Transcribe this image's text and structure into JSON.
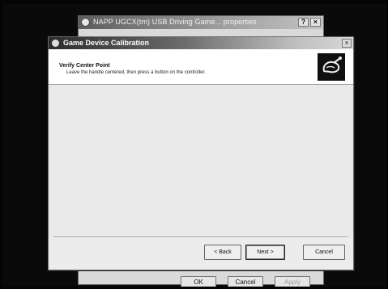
{
  "back_window": {
    "title": "NAPP UGCX(tm) USB Driving Game... properties",
    "help_glyph": "?",
    "close_glyph": "×",
    "buttons": {
      "ok": "OK",
      "cancel": "Cancel",
      "apply": "Apply"
    }
  },
  "dialog": {
    "title": "Game Device Calibration",
    "close_glyph": "×",
    "header": {
      "title": "Verify Center Point",
      "subtitle": "Leave the handle centered, then press a button on the controller."
    },
    "icon": "game-controller-icon",
    "buttons": {
      "back": "< Back",
      "next": "Next >",
      "cancel": "Cancel"
    }
  }
}
